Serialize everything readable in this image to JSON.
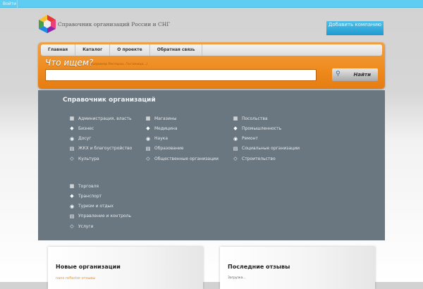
{
  "topbar": {
    "login": "Войти"
  },
  "header": {
    "site_title": "Справочник организаций России и СНГ",
    "add_company": "Добавить компанию"
  },
  "nav": [
    "Главная",
    "Каталог",
    "О проекте",
    "Обратная связь"
  ],
  "search": {
    "label": "Что ищем?",
    "hint": "(например Ресторан, Гостиница...)",
    "value": "",
    "button": "Найти"
  },
  "directory": {
    "title": "Справочник организаций",
    "col1": [
      "Администрация, власть",
      "Бизнес",
      "Досуг",
      "ЖКХ и благоустройство",
      "Культура"
    ],
    "col2": [
      "Магазины",
      "Медицина",
      "Наука",
      "Образование",
      "Общественные организации"
    ],
    "col3": [
      "Посольства",
      "Промышленность",
      "Ремонт",
      "Социальные организации",
      "Строительство"
    ],
    "col4": [
      "Торговля",
      "Транспорт",
      "Туризм и отдых",
      "Управление и контроль",
      "Услуги"
    ]
  },
  "new_orgs": {
    "title": "Новые организации",
    "first": "nano reflector отзывы"
  },
  "reviews": {
    "title": "Последние отзывы",
    "status": "Загрузка..."
  },
  "colors": {
    "topbar": "#5fcdf2",
    "orange": "#ef8a1c",
    "panel": "#6a7781",
    "link": "#e8962a"
  }
}
